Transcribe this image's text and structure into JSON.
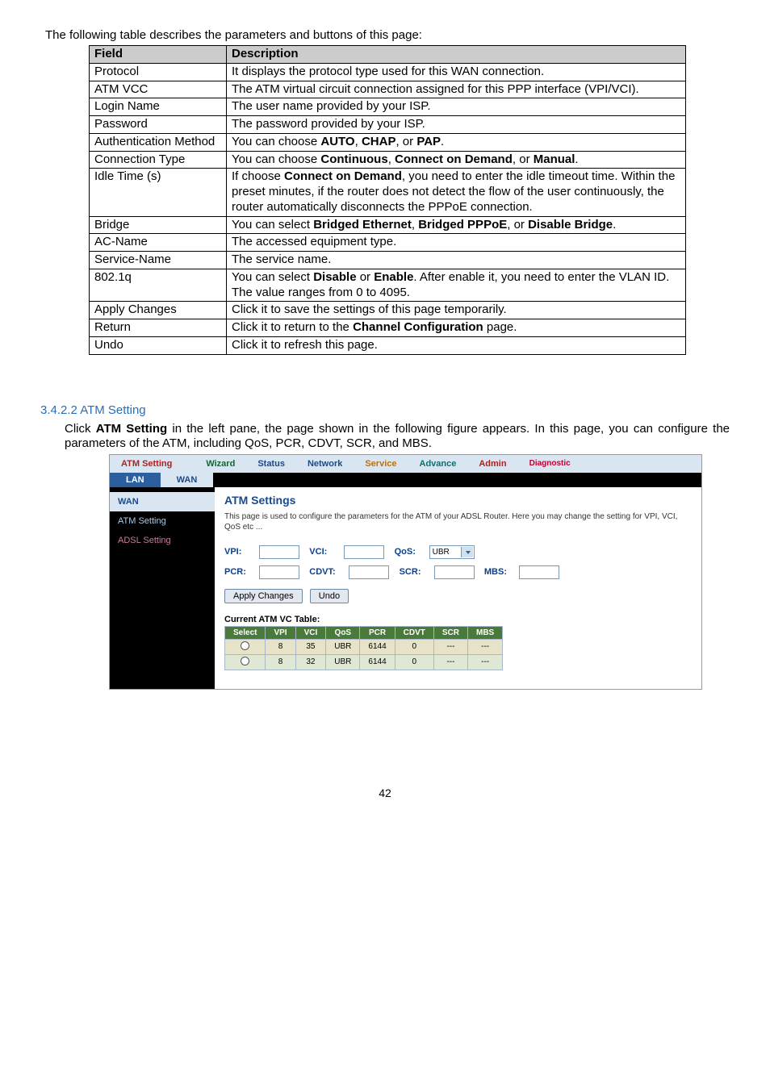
{
  "intro": "The following table describes the parameters and buttons of this page:",
  "table_headers": {
    "field": "Field",
    "desc": "Description"
  },
  "rows": [
    {
      "f": "Protocol",
      "d": "It displays the protocol type used for this WAN connection."
    },
    {
      "f": "ATM VCC",
      "d": "The ATM virtual circuit connection assigned for this PPP interface (VPI/VCI)."
    },
    {
      "f": "Login Name",
      "d": "The user name provided by your ISP."
    },
    {
      "f": "Password",
      "d": "The password provided by your ISP."
    },
    {
      "f": "Authentication Method",
      "d_html": "You can choose <span class='b'>AUTO</span>, <span class='b'>CHAP</span>, or <span class='b'>PAP</span>."
    },
    {
      "f": "Connection Type",
      "d_html": "You can choose <span class='b'>Continuous</span>, <span class='b'>Connect on Demand</span>, or <span class='b'>Manual</span>."
    },
    {
      "f": "Idle Time (s)",
      "d_html": "If choose <span class='b'>Connect on Demand</span>, you need to enter the idle timeout time. Within the preset minutes, if the router does not detect the flow of the user continuously, the router automatically disconnects the PPPoE connection."
    },
    {
      "f": "Bridge",
      "d_html": "You can select <span class='b'>Bridged Ethernet</span>, <span class='b'>Bridged PPPoE</span>, or <span class='b'>Disable Bridge</span>."
    },
    {
      "f": "AC-Name",
      "d": "The accessed equipment type."
    },
    {
      "f": "Service-Name",
      "d": "The service name."
    },
    {
      "f": "802.1q",
      "d_html": "You can select <span class='b'>Disable</span> or <span class='b'>Enable</span>. After enable it, you need to enter the VLAN ID. The value ranges from 0 to 4095."
    },
    {
      "f": "Apply Changes",
      "d": "Click it to save the settings of this page temporarily."
    },
    {
      "f": "Return",
      "d_html": "Click it to return to the <span class='b'>Channel Configuration</span> page."
    },
    {
      "f": "Undo",
      "d": "Click it to refresh this page."
    }
  ],
  "section_num": "3.4.2.2 ATM Setting",
  "section_para_html": "Click <span class='b'>ATM Setting</span> in the left pane, the page shown in the following figure appears. In this page, you can configure the parameters of the ATM, including QoS, PCR, CDVT, SCR, and MBS.",
  "nav": {
    "items": [
      {
        "label": "ATM Setting",
        "cls": "nav-red"
      },
      {
        "label": "Wizard",
        "cls": "nav-green"
      },
      {
        "label": "Status",
        "cls": "nav-blue"
      },
      {
        "label": "Network",
        "cls": "nav-blue"
      },
      {
        "label": "Service",
        "cls": "nav-orange"
      },
      {
        "label": "Advance",
        "cls": "nav-teal"
      },
      {
        "label": "Admin",
        "cls": "nav-red"
      },
      {
        "label": "Diagnostic",
        "cls": "nav-diag"
      }
    ]
  },
  "subtabs": {
    "lan": "LAN",
    "wan": "WAN"
  },
  "side": {
    "wan": "WAN",
    "atm": "ATM Setting",
    "adsl": "ADSL Setting"
  },
  "panel": {
    "title": "ATM Settings",
    "note": "This page is used to configure the parameters for the ATM of your ADSL Router. Here you may change the setting for VPI, VCI, QoS etc ...",
    "labels": {
      "vpi": "VPI:",
      "vci": "VCI:",
      "qos": "QoS:",
      "pcr": "PCR:",
      "cdvt": "CDVT:",
      "scr": "SCR:",
      "mbs": "MBS:"
    },
    "qos_value": "UBR",
    "apply": "Apply Changes",
    "undo": "Undo",
    "vc_title": "Current ATM VC Table:",
    "vc_headers": [
      "Select",
      "VPI",
      "VCI",
      "QoS",
      "PCR",
      "CDVT",
      "SCR",
      "MBS"
    ],
    "vc_rows": [
      {
        "vpi": "8",
        "vci": "35",
        "qos": "UBR",
        "pcr": "6144",
        "cdvt": "0",
        "scr": "---",
        "mbs": "---"
      },
      {
        "vpi": "8",
        "vci": "32",
        "qos": "UBR",
        "pcr": "6144",
        "cdvt": "0",
        "scr": "---",
        "mbs": "---"
      }
    ]
  },
  "pagenum": "42"
}
